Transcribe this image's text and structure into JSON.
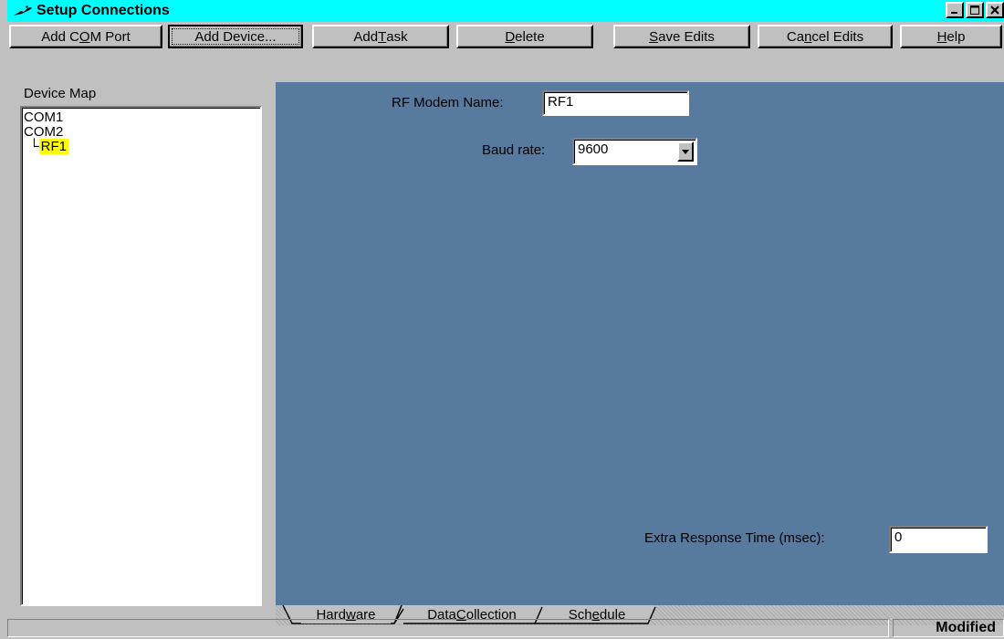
{
  "window": {
    "title": "Setup Connections",
    "icons": {
      "app": "wrench-icon",
      "minimize": "minimize-icon",
      "maximize": "maximize-icon",
      "close": "close-icon"
    }
  },
  "toolbar": {
    "add_com_port": {
      "pre": "Add C",
      "u": "O",
      "post": "M Port"
    },
    "add_device": "Add Device...",
    "add_task": {
      "pre": "Add ",
      "u": "T",
      "post": "ask"
    },
    "delete": {
      "pre": "",
      "u": "D",
      "post": "elete"
    },
    "save_edits": {
      "pre": "",
      "u": "S",
      "post": "ave Edits"
    },
    "cancel_edits": {
      "pre": "Ca",
      "u": "n",
      "post": "cel Edits"
    },
    "help": {
      "pre": "",
      "u": "H",
      "post": "elp"
    }
  },
  "device_map": {
    "label": "Device Map",
    "items": [
      {
        "label": "COM1"
      },
      {
        "label": "COM2"
      },
      {
        "label": "RF1",
        "prefix": "└",
        "selected": true
      }
    ],
    "selected_color": "#ffff00"
  },
  "form": {
    "modem_name_label": "RF Modem Name:",
    "modem_name_value": "RF1",
    "baud_label": "Baud rate:",
    "baud_value": "9600",
    "extra_label": "Extra Response Time (msec):",
    "extra_value": "0",
    "pane_color": "#587a9e"
  },
  "tabs": [
    {
      "pre": "Hard",
      "u": "w",
      "post": "are",
      "active": true
    },
    {
      "pre": "Data ",
      "u": "C",
      "post": "ollection",
      "active": false
    },
    {
      "pre": "Sch",
      "u": "e",
      "post": "dule",
      "active": false
    }
  ],
  "status": {
    "state": "Modified"
  },
  "colors": {
    "titlebar": "#00ffff",
    "face": "#c0c0c0"
  }
}
